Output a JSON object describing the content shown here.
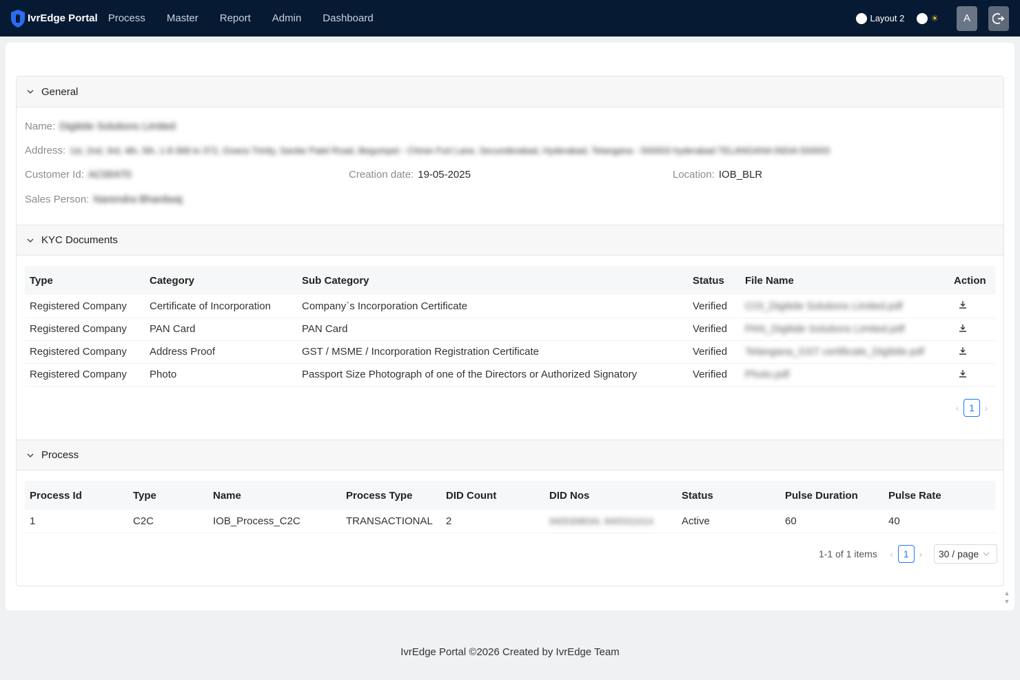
{
  "app": {
    "name": "IvrEdge Portal"
  },
  "nav": {
    "items": [
      "Process",
      "Master",
      "Report",
      "Admin",
      "Dashboard"
    ]
  },
  "topbar": {
    "layout_label": "Layout 2",
    "avatar_letter": "A"
  },
  "general": {
    "title": "General",
    "name_label": "Name:",
    "name_value": "Digitide Solutions Limited",
    "address_label": "Address:",
    "address_value": "1st, 2nd, 3rd, 4th, 5th, 1-8-368 to 372, Gowra Trinity, Sardar Patel Road, Begumpet - Chiran Fort Lane, Secunderabad, Hyderabad, Telangana - 500003 hyderabad TELANGANA INDIA 500003",
    "customer_id_label": "Customer Id:",
    "customer_id_value": "AC00470",
    "creation_date_label": "Creation date:",
    "creation_date_value": "19-05-2025",
    "location_label": "Location:",
    "location_value": "IOB_BLR",
    "sales_person_label": "Sales Person:",
    "sales_person_value": "Narendra Bhardwaj"
  },
  "kyc": {
    "title": "KYC Documents",
    "columns": [
      "Type",
      "Category",
      "Sub Category",
      "Status",
      "File Name",
      "Action"
    ],
    "rows": [
      {
        "type": "Registered Company",
        "category": "Certificate of Incorporation",
        "sub_category": "Company`s Incorporation Certificate",
        "status": "Verified",
        "file_name": "COI_Digitide Solutions Limited.pdf",
        "action_icon": "download-icon"
      },
      {
        "type": "Registered Company",
        "category": "PAN Card",
        "sub_category": "PAN Card",
        "status": "Verified",
        "file_name": "PAN_Digitide Solutions Limited.pdf",
        "action_icon": "download-icon"
      },
      {
        "type": "Registered Company",
        "category": "Address Proof",
        "sub_category": "GST / MSME / Incorporation Registration Certificate",
        "status": "Verified",
        "file_name": "Telangana_GST certificate_Digitide.pdf",
        "action_icon": "download-icon"
      },
      {
        "type": "Registered Company",
        "category": "Photo",
        "sub_category": "Passport Size Photograph of one of the Directors or Authorized Signatory",
        "status": "Verified",
        "file_name": "Photo.pdf",
        "action_icon": "download-icon"
      }
    ],
    "page": "1"
  },
  "process": {
    "title": "Process",
    "columns": [
      "Process Id",
      "Type",
      "Name",
      "Process Type",
      "DID Count",
      "DID Nos",
      "Status",
      "Pulse Duration",
      "Pulse Rate"
    ],
    "rows": [
      {
        "process_id": "1",
        "type": "C2C",
        "name": "IOB_Process_C2C",
        "process_type": "TRANSACTIONAL",
        "did_count": "2",
        "did_nos": "9405308034, 9405311014",
        "status": "Active",
        "pulse_duration": "60",
        "pulse_rate": "40"
      }
    ],
    "items_summary": "1-1 of 1 items",
    "page": "1",
    "page_size": "30 / page"
  },
  "footer": {
    "text": "IvrEdge Portal ©2026 Created by IvrEdge Team"
  },
  "colors": {
    "topbar": "#071a33",
    "accent": "#1677ff"
  }
}
